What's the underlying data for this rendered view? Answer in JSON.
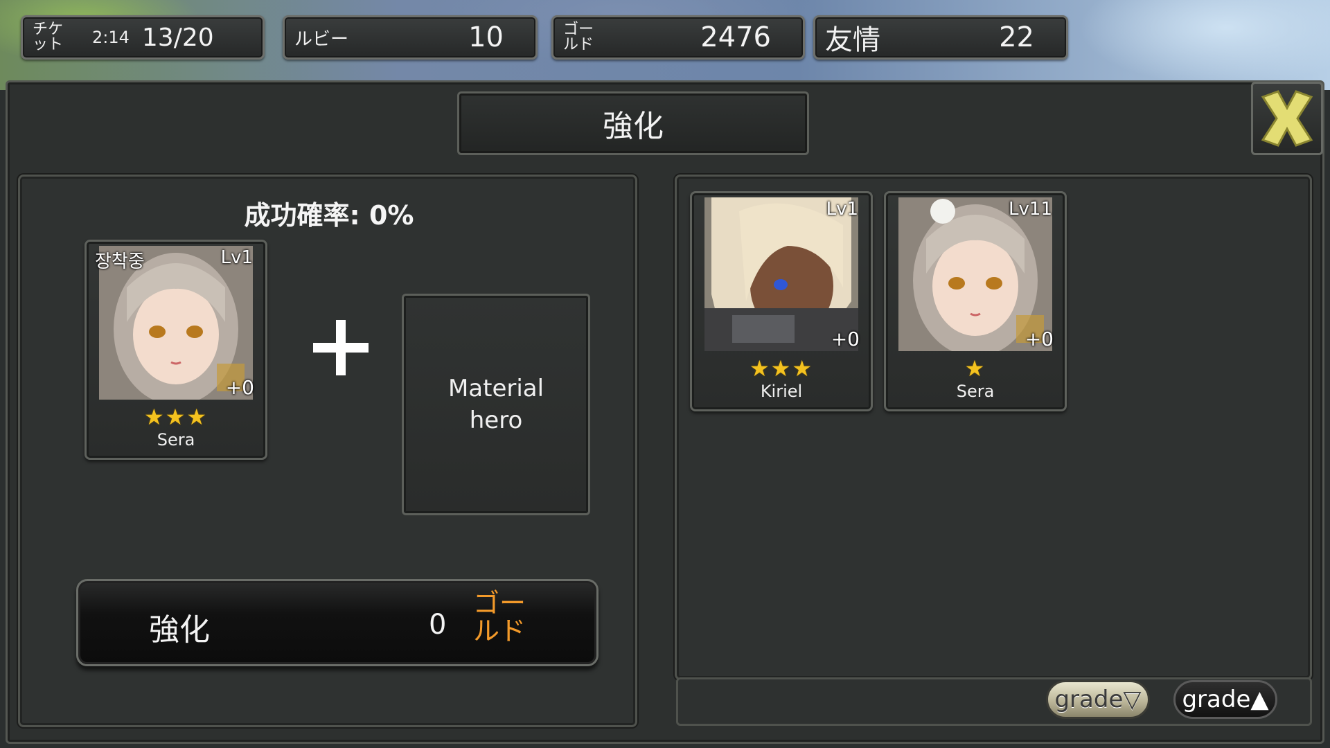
{
  "resources": {
    "ticket": {
      "label": "チケット",
      "timer": "2:14",
      "value": "13/20"
    },
    "ruby": {
      "label": "ルビー",
      "value": "10"
    },
    "gold": {
      "label": "ゴールド",
      "value": "2476"
    },
    "friendship": {
      "label": "友情",
      "value": "22"
    }
  },
  "title": "強化",
  "close_icon": "close-x-icon",
  "colors": {
    "accent_gold": "#f39a2a",
    "star": "#f4c21f",
    "close_x": "#e6e07a"
  },
  "left_panel": {
    "success_rate_label": "成功確率: 0%",
    "base_hero": {
      "equip_label": "장착중",
      "level": "Lv1",
      "plus": "+0",
      "stars": "★★★",
      "star_count": 3,
      "name": "Sera"
    },
    "material_label": "Material hero",
    "enhance_button": {
      "label": "強化",
      "cost": "0",
      "unit": "ゴールド"
    }
  },
  "hero_list": [
    {
      "level": "Lv1",
      "plus": "+0",
      "stars": "★★★",
      "star_count": 3,
      "name": "Kiriel"
    },
    {
      "level": "Lv11",
      "plus": "+0",
      "stars": "★",
      "star_count": 1,
      "name": "Sera"
    }
  ],
  "sort": {
    "grade_desc": "grade▽",
    "grade_asc": "grade▲"
  }
}
